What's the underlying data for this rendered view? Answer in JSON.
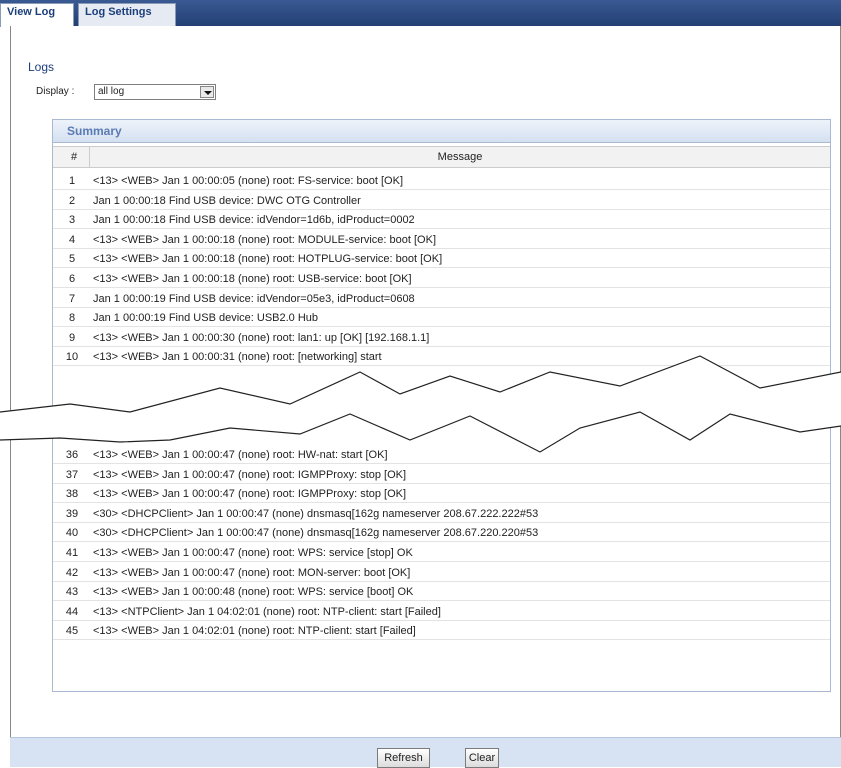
{
  "tabs": [
    {
      "label": "View Log",
      "active": true
    },
    {
      "label": "Log Settings",
      "active": false
    }
  ],
  "logs_title": "Logs",
  "display": {
    "label": "Display :",
    "value": "all log"
  },
  "summary": {
    "title": "Summary",
    "columns": [
      "#",
      "Message"
    ],
    "rows_top": [
      {
        "num": "1",
        "msg": "<13> <WEB> Jan 1 00:00:05 (none) root: FS-service: boot [OK]"
      },
      {
        "num": "2",
        "msg": "Jan 1 00:00:18 Find USB device: DWC OTG Controller"
      },
      {
        "num": "3",
        "msg": "Jan 1 00:00:18 Find USB device: idVendor=1d6b, idProduct=0002"
      },
      {
        "num": "4",
        "msg": "<13> <WEB> Jan 1 00:00:18 (none) root: MODULE-service: boot [OK]"
      },
      {
        "num": "5",
        "msg": "<13> <WEB> Jan 1 00:00:18 (none) root: HOTPLUG-service: boot [OK]"
      },
      {
        "num": "6",
        "msg": "<13> <WEB> Jan 1 00:00:18 (none) root: USB-service: boot [OK]"
      },
      {
        "num": "7",
        "msg": "Jan 1 00:00:19 Find USB device: idVendor=05e3, idProduct=0608"
      },
      {
        "num": "8",
        "msg": "Jan 1 00:00:19 Find USB device: USB2.0 Hub"
      },
      {
        "num": "9",
        "msg": "<13> <WEB> Jan 1 00:00:30 (none) root: lan1: up [OK] [192.168.1.1]"
      },
      {
        "num": "10",
        "msg": "<13> <WEB> Jan 1 00:00:31 (none) root: [networking] start"
      }
    ],
    "rows_bottom": [
      {
        "num": "36",
        "msg": "<13> <WEB> Jan 1 00:00:47 (none) root: HW-nat: start [OK]"
      },
      {
        "num": "37",
        "msg": "<13> <WEB> Jan 1 00:00:47 (none) root: IGMPProxy: stop [OK]"
      },
      {
        "num": "38",
        "msg": "<13> <WEB> Jan 1 00:00:47 (none) root: IGMPProxy: stop [OK]"
      },
      {
        "num": "39",
        "msg": "<30> <DHCPClient> Jan 1 00:00:47 (none) dnsmasq[162g nameserver 208.67.222.222#53"
      },
      {
        "num": "40",
        "msg": "<30> <DHCPClient> Jan 1 00:00:47 (none) dnsmasq[162g nameserver 208.67.220.220#53"
      },
      {
        "num": "41",
        "msg": "<13> <WEB> Jan 1 00:00:47 (none) root: WPS: service [stop] OK"
      },
      {
        "num": "42",
        "msg": "<13> <WEB> Jan 1 00:00:47 (none) root: MON-server: boot [OK]"
      },
      {
        "num": "43",
        "msg": "<13> <WEB> Jan 1 00:00:48 (none) root: WPS: service [boot] OK"
      },
      {
        "num": "44",
        "msg": "<13> <NTPClient> Jan 1 04:02:01 (none) root: NTP-client: start [Failed]"
      },
      {
        "num": "45",
        "msg": "<13> <WEB> Jan 1 04:02:01 (none) root: NTP-client: start [Failed]"
      }
    ]
  },
  "buttons": {
    "refresh": "Refresh",
    "clear": "Clear"
  }
}
